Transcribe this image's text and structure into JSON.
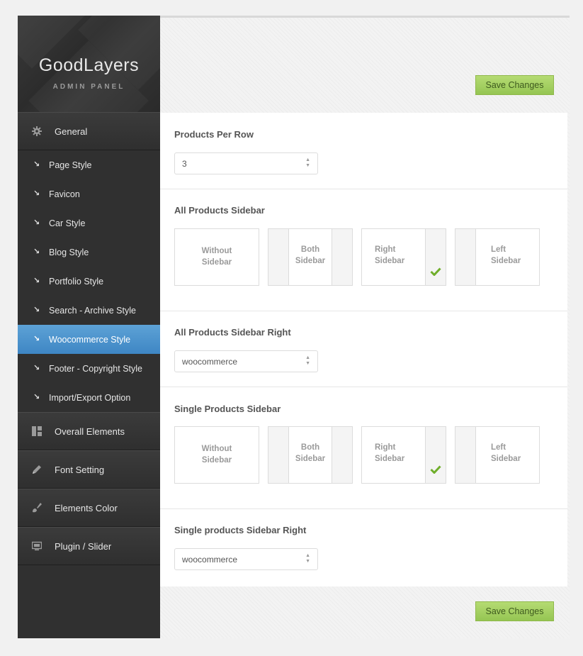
{
  "brand": {
    "title": "GoodLayers",
    "subtitle": "ADMIN PANEL"
  },
  "sidebar": {
    "general": {
      "label": "General",
      "icon": "gear-icon"
    },
    "sub_items": [
      {
        "label": "Page Style"
      },
      {
        "label": "Favicon"
      },
      {
        "label": "Car Style"
      },
      {
        "label": "Blog Style"
      },
      {
        "label": "Portfolio Style"
      },
      {
        "label": "Search - Archive Style"
      },
      {
        "label": "Woocommerce Style",
        "active": true
      },
      {
        "label": "Footer - Copyright Style"
      },
      {
        "label": "Import/Export Option"
      }
    ],
    "sections": [
      {
        "label": "Overall Elements",
        "icon": "layout-icon"
      },
      {
        "label": "Font Setting",
        "icon": "pencil-icon"
      },
      {
        "label": "Elements Color",
        "icon": "brush-icon"
      },
      {
        "label": "Plugin / Slider",
        "icon": "monitor-icon"
      }
    ],
    "arrow_glyph": "↘"
  },
  "toolbar": {
    "save_label": "Save Changes"
  },
  "settings": {
    "products_per_row": {
      "title": "Products Per Row",
      "value": "3"
    },
    "all_products_sidebar": {
      "title": "All Products Sidebar",
      "options": [
        {
          "line1": "Without",
          "line2": "Sidebar"
        },
        {
          "line1": "Both",
          "line2": "Sidebar"
        },
        {
          "line1": "Right",
          "line2": "Sidebar"
        },
        {
          "line1": "Left",
          "line2": "Sidebar"
        }
      ],
      "selected": "Right Sidebar"
    },
    "all_products_sidebar_right": {
      "title": "All Products Sidebar Right",
      "value": "woocommerce"
    },
    "single_products_sidebar": {
      "title": "Single Products Sidebar",
      "options": [
        {
          "line1": "Without",
          "line2": "Sidebar"
        },
        {
          "line1": "Both",
          "line2": "Sidebar"
        },
        {
          "line1": "Right",
          "line2": "Sidebar"
        },
        {
          "line1": "Left",
          "line2": "Sidebar"
        }
      ],
      "selected": "Right Sidebar"
    },
    "single_products_sidebar_right": {
      "title": "Single products Sidebar Right",
      "value": "woocommerce"
    }
  },
  "colors": {
    "accent_active": "#4a93cc",
    "save_green": "#a6d163",
    "check_green": "#6fae2a"
  }
}
